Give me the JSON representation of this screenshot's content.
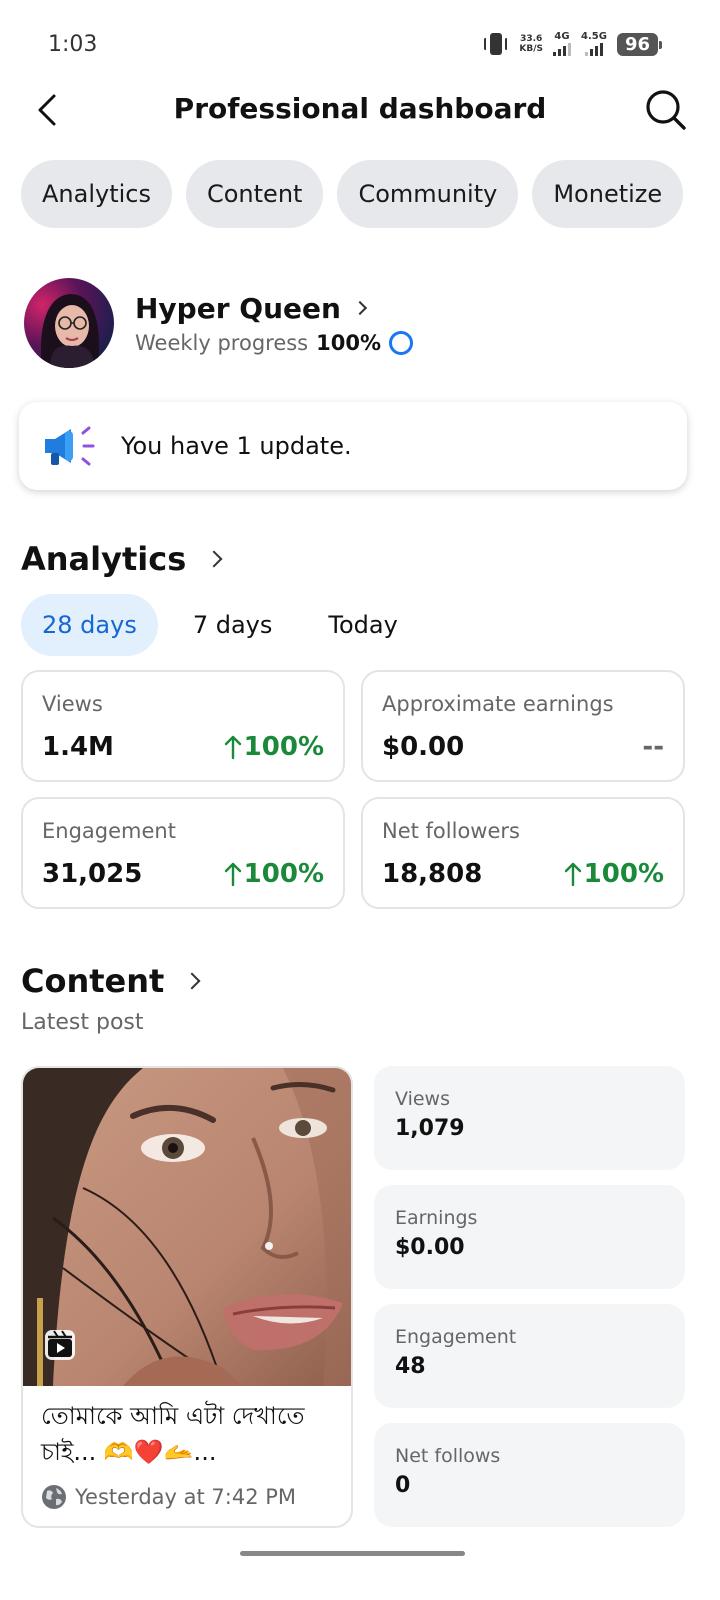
{
  "status": {
    "time": "1:03",
    "speed_top": "33.6",
    "speed_unit": "KB/S",
    "sig1_label": "4G",
    "sig2_label": "4.5G",
    "battery": "96"
  },
  "header": {
    "title": "Professional dashboard"
  },
  "chips": [
    "Analytics",
    "Content",
    "Community",
    "Monetize"
  ],
  "profile": {
    "name": "Hyper Queen",
    "progress_label": "Weekly progress",
    "progress_value": "100%"
  },
  "update": {
    "text": "You have 1 update."
  },
  "analytics": {
    "title": "Analytics",
    "tabs": [
      "28 days",
      "7 days",
      "Today"
    ],
    "active_tab": "28 days",
    "stats": [
      {
        "label": "Views",
        "value": "1.4M",
        "change": "100%"
      },
      {
        "label": "Approximate earnings",
        "value": "$0.00",
        "change": "--"
      },
      {
        "label": "Engagement",
        "value": "31,025",
        "change": "100%"
      },
      {
        "label": "Net followers",
        "value": "18,808",
        "change": "100%"
      }
    ]
  },
  "content": {
    "title": "Content",
    "subtitle": "Latest post",
    "post": {
      "caption": "তোমাকে আমি এটা দেখাতে চাই... 🫶❤️🫴...",
      "time": "Yesterday at 7:42 PM"
    },
    "stats": [
      {
        "label": "Views",
        "value": "1,079"
      },
      {
        "label": "Earnings",
        "value": "$0.00"
      },
      {
        "label": "Engagement",
        "value": "48"
      },
      {
        "label": "Net follows",
        "value": "0"
      }
    ]
  },
  "colors": {
    "accent": "#1877f2",
    "positive": "#1a8a3a",
    "chip_bg": "#e6e8eb",
    "active_tab_bg": "#e2effd"
  }
}
